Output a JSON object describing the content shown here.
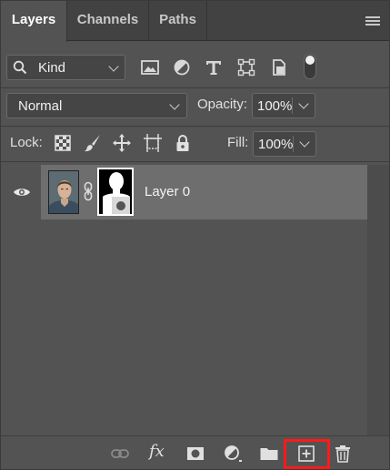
{
  "tabs": [
    {
      "label": "Layers",
      "active": true
    },
    {
      "label": "Channels",
      "active": false
    },
    {
      "label": "Paths",
      "active": false
    }
  ],
  "filter": {
    "kind_label": "Kind",
    "icons": [
      "image-filter-icon",
      "adjustment-filter-icon",
      "type-filter-icon",
      "shape-filter-icon",
      "smart-object-filter-icon"
    ],
    "filter_toggle": "on"
  },
  "blend": {
    "mode": "Normal",
    "opacity_label": "Opacity:",
    "opacity_value": "100%"
  },
  "lock": {
    "label": "Lock:",
    "icons": [
      "lock-transparent-pixels-icon",
      "lock-image-pixels-icon",
      "lock-position-icon",
      "lock-artboard-icon",
      "lock-all-icon"
    ],
    "fill_label": "Fill:",
    "fill_value": "100%"
  },
  "layers": [
    {
      "name": "Layer 0",
      "visible": true,
      "has_mask": true,
      "selected": true
    }
  ],
  "bottom_bar": {
    "icons": [
      "link-layers-icon",
      "fx-icon",
      "add-mask-icon",
      "new-adjustment-icon",
      "new-group-icon",
      "new-layer-icon",
      "delete-layer-icon"
    ],
    "fx_label": "fx",
    "highlighted": "new-layer-icon",
    "highlight_color": "#ff1a1a"
  },
  "colors": {
    "panel_bg": "#535353",
    "tabbar_bg": "#424242",
    "selected_row": "#6e6e6e"
  }
}
